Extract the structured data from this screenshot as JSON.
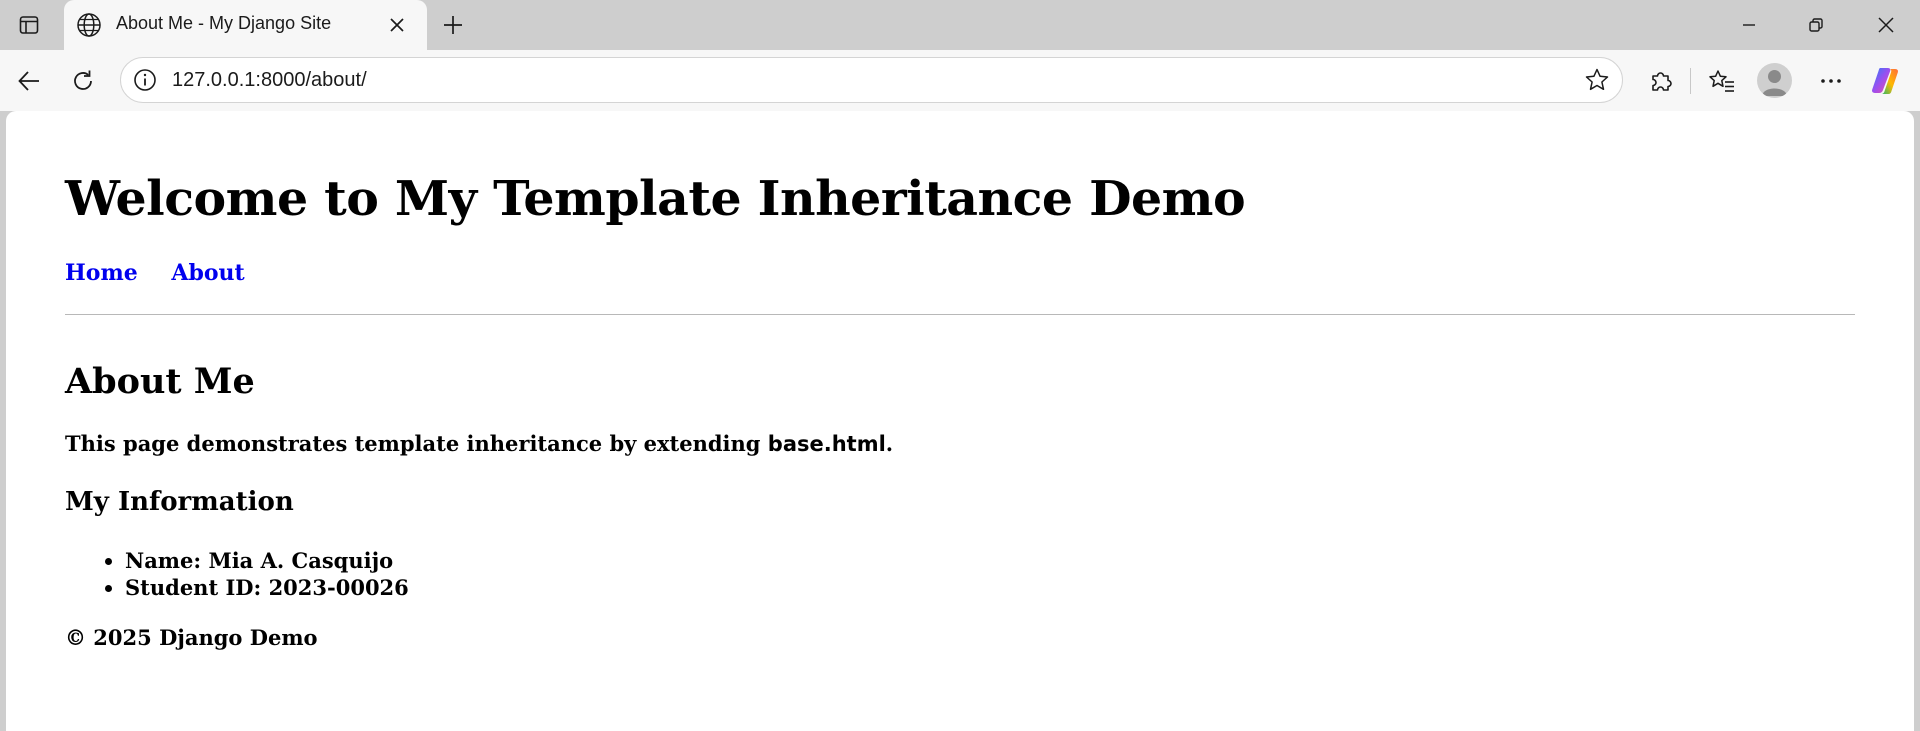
{
  "browser": {
    "tab_title": "About Me - My Django Site",
    "url": "127.0.0.1:8000/about/"
  },
  "page": {
    "site_title": "Welcome to My Template Inheritance Demo",
    "nav": [
      {
        "label": "Home"
      },
      {
        "label": "About"
      }
    ],
    "heading": "About Me",
    "intro_text": "This page demonstrates template inheritance by extending",
    "intro_code": "base.html",
    "intro_end": ".",
    "section_heading": "My Information",
    "info_items": [
      {
        "label": "Name:",
        "value": "Mia A. Casquijo"
      },
      {
        "label": "Student ID:",
        "value": "2023-00026"
      }
    ],
    "footer": "© 2025 Django Demo"
  },
  "colors": {
    "link": "#0000ee",
    "chrome": "#cecece",
    "toolbar": "#f7f7f7"
  }
}
